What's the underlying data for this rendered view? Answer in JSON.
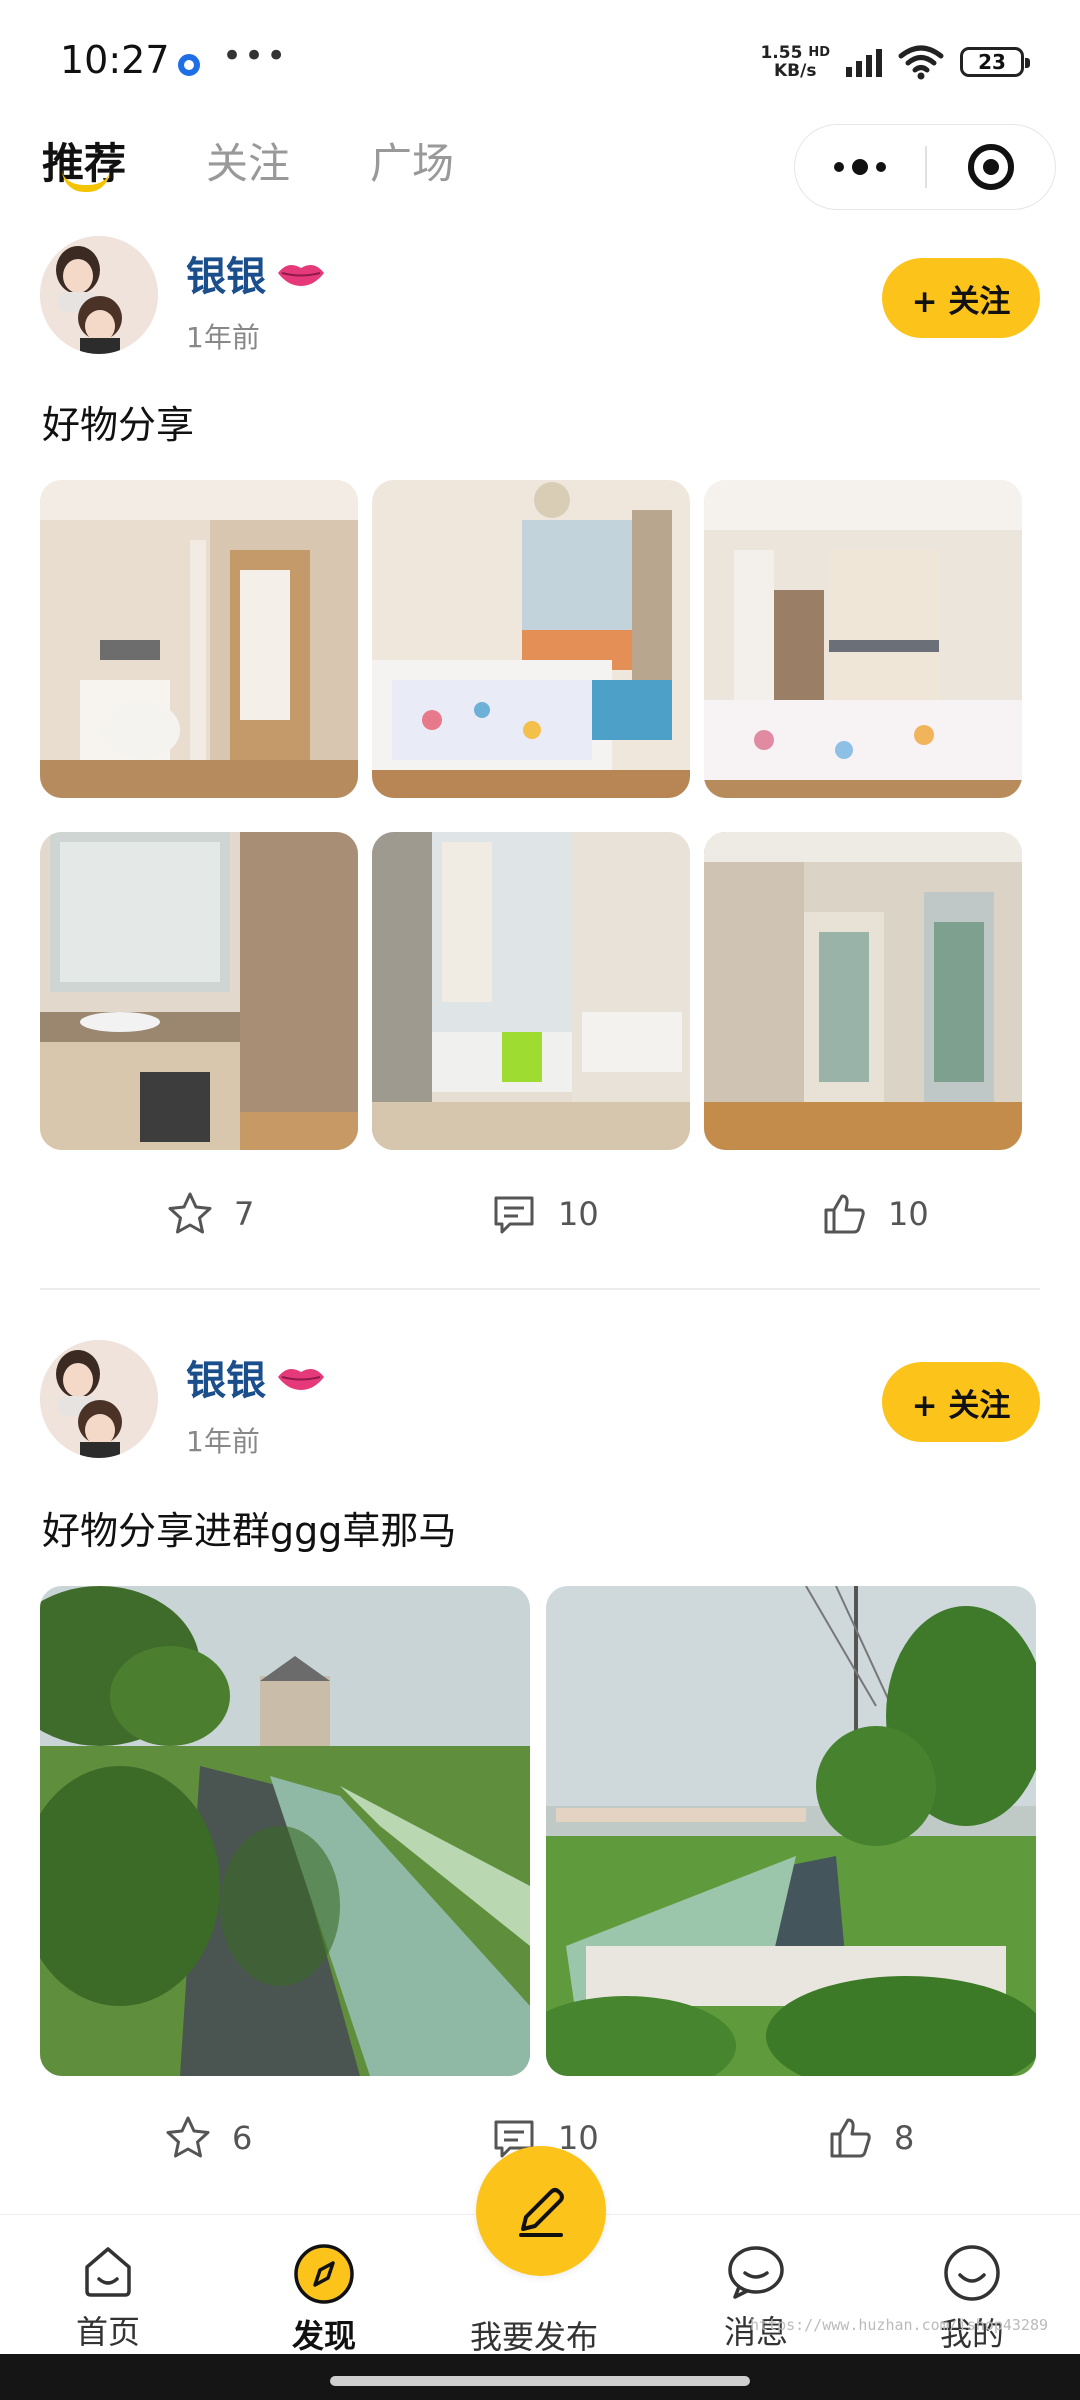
{
  "status_bar": {
    "time": "10:27",
    "net_speed": "1.55",
    "net_unit": "KB/s",
    "net_type": "HD",
    "battery": "23"
  },
  "header": {
    "tabs": [
      {
        "label": "推荐",
        "active": true
      },
      {
        "label": "关注",
        "active": false
      },
      {
        "label": "广场",
        "active": false
      }
    ],
    "accent_color": "#fcc41a"
  },
  "posts": [
    {
      "author": "银银",
      "time_ago": "1年前",
      "follow_label": "+ 关注",
      "text": "好物分享",
      "images": [
        "bathroom-toilet",
        "bedroom-window",
        "bedroom-wardrobe",
        "bathroom-vanity",
        "shower-room",
        "hallway"
      ],
      "favorites": "7",
      "comments": "10",
      "likes": "10"
    },
    {
      "author": "银银",
      "time_ago": "1年前",
      "follow_label": "+ 关注",
      "text": "好物分享进群ggg草那马",
      "images": [
        "canal-village",
        "canal-field"
      ],
      "favorites": "6",
      "comments": "10",
      "likes": "8"
    }
  ],
  "bottom_nav": {
    "items": [
      {
        "label": "首页",
        "icon": "home-icon"
      },
      {
        "label": "发现",
        "icon": "compass-icon",
        "active": true
      },
      {
        "label": "我要发布",
        "icon": "pencil-icon"
      },
      {
        "label": "消息",
        "icon": "chat-icon"
      },
      {
        "label": "我的",
        "icon": "smile-icon"
      }
    ]
  },
  "watermark": "https://www.huzhan.com/ishop43289"
}
